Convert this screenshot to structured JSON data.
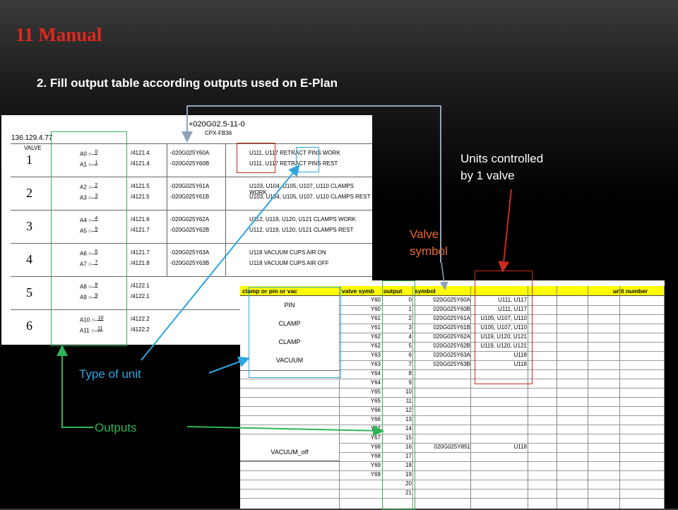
{
  "slide": {
    "title": "11 Manual",
    "subtitle": "2. Fill output table according outputs used on E-Plan"
  },
  "notes": {
    "units": [
      "Units controlled",
      "by 1 valve"
    ],
    "valve": [
      "Valve",
      "symbol"
    ],
    "type": "Type of unit",
    "outputs": "Outputs"
  },
  "eplan": {
    "ip": "136.129.4.77",
    "header_line1": "+020G02.5-11-0",
    "header_line2": "CPX-FB36",
    "valve_label": "VALVE",
    "rows": [
      {
        "valve": "1",
        "io": [
          [
            "A0",
            "0"
          ],
          [
            "A1",
            "1"
          ]
        ],
        "pages": [
          "/4121.4",
          "/4121.4"
        ],
        "codes": [
          "-020G025Y60A",
          "-020G025Y60B"
        ],
        "desc": [
          "U111, U117 RETRACT PINS WORK",
          "U111, U117 RETRACT PINS REST"
        ]
      },
      {
        "valve": "2",
        "io": [
          [
            "A2",
            "2"
          ],
          [
            "A3",
            "3"
          ]
        ],
        "pages": [
          "/4121.5",
          "/4121.5"
        ],
        "codes": [
          "-020G025Y61A",
          "-020G025Y61B"
        ],
        "desc": [
          "U103, U104, U105, U107, U110 CLAMPS WORK",
          "U103, U104, U105, U107, U110 CLAMPS REST"
        ]
      },
      {
        "valve": "3",
        "io": [
          [
            "A4",
            "4"
          ],
          [
            "A5",
            "5"
          ]
        ],
        "pages": [
          "/4121.6",
          "/4121.7"
        ],
        "codes": [
          "-020G025Y62A",
          "-020G025Y62B"
        ],
        "desc": [
          "U112, U119, U120, U121 CLAMPS WORK",
          "U112, U119, U120, U121 CLAMPS REST"
        ]
      },
      {
        "valve": "4",
        "io": [
          [
            "A6",
            "6"
          ],
          [
            "A7",
            "7"
          ]
        ],
        "pages": [
          "/4121.7",
          "/4121.8"
        ],
        "codes": [
          "-020G025Y63A",
          "-020G025Y63B"
        ],
        "desc": [
          "U118 VACUUM CUPS AIR ON",
          "U118 VACUUM CUPS AIR OFF"
        ]
      },
      {
        "valve": "5",
        "io": [
          [
            "A8",
            "8"
          ],
          [
            "A9",
            "9"
          ]
        ],
        "pages": [
          "/4122.1",
          "/4122.1"
        ],
        "codes": [
          "",
          ""
        ],
        "desc": [
          "",
          ""
        ]
      },
      {
        "valve": "6",
        "io": [
          [
            "A10",
            "10"
          ],
          [
            "A11",
            "11"
          ]
        ],
        "pages": [
          "/4122.2",
          "/4122.2"
        ],
        "codes": [
          "",
          ""
        ],
        "desc": [
          "",
          ""
        ]
      }
    ]
  },
  "excel": {
    "headers": {
      "type": "clamp or pin or vac",
      "valve": "valve symb",
      "output": "output",
      "symbol": "symbol",
      "units": "unit number"
    },
    "groups": [
      {
        "name": "PIN",
        "start": 0,
        "span": 2
      },
      {
        "name": "CLAMP",
        "start": 2,
        "span": 2
      },
      {
        "name": "CLAMP",
        "start": 4,
        "span": 2
      },
      {
        "name": "VACUUM",
        "start": 6,
        "span": 2
      },
      {
        "name": "VACUUM_off",
        "start": 16,
        "span": 1
      }
    ],
    "rows": [
      {
        "valve": "Y60",
        "output": "0",
        "symbol": "020G025Y60A",
        "unit": "U111, U117"
      },
      {
        "valve": "Y60",
        "output": "1",
        "symbol": "020G025Y60B",
        "unit": "U111, U117"
      },
      {
        "valve": "Y61",
        "output": "2",
        "symbol": "020G025Y61A",
        "unit": "U105, U107, U110"
      },
      {
        "valve": "Y61",
        "output": "3",
        "symbol": "020G025Y61B",
        "unit": "U105, U107, U110"
      },
      {
        "valve": "Y62",
        "output": "4",
        "symbol": "020G025Y62A",
        "unit": "U119, U120, U121"
      },
      {
        "valve": "Y62",
        "output": "5",
        "symbol": "020G025Y62B",
        "unit": "U119, U120, U121"
      },
      {
        "valve": "Y63",
        "output": "6",
        "symbol": "020G025Y63A",
        "unit": "U118"
      },
      {
        "valve": "Y63",
        "output": "7",
        "symbol": "020G025Y63B",
        "unit": "U118"
      },
      {
        "valve": "Y64",
        "output": "8",
        "symbol": "",
        "unit": ""
      },
      {
        "valve": "Y64",
        "output": "9",
        "symbol": "",
        "unit": ""
      },
      {
        "valve": "Y65",
        "output": "10",
        "symbol": "",
        "unit": ""
      },
      {
        "valve": "Y65",
        "output": "11",
        "symbol": "",
        "unit": ""
      },
      {
        "valve": "Y66",
        "output": "12",
        "symbol": "",
        "unit": ""
      },
      {
        "valve": "Y66",
        "output": "13",
        "symbol": "",
        "unit": ""
      },
      {
        "valve": "Y67",
        "output": "14",
        "symbol": "",
        "unit": ""
      },
      {
        "valve": "Y67",
        "output": "15",
        "symbol": "",
        "unit": ""
      },
      {
        "valve": "Y68",
        "output": "16",
        "symbol": "020G025Y851",
        "unit": "U118"
      },
      {
        "valve": "Y68",
        "output": "17",
        "symbol": "",
        "unit": ""
      },
      {
        "valve": "Y69",
        "output": "18",
        "symbol": "",
        "unit": ""
      },
      {
        "valve": "Y69",
        "output": "19",
        "symbol": "",
        "unit": ""
      },
      {
        "valve": "",
        "output": "20",
        "symbol": "",
        "unit": ""
      },
      {
        "valve": "",
        "output": "21",
        "symbol": "",
        "unit": ""
      }
    ]
  },
  "colors": {
    "title": "#e0281e",
    "units_box": "#cc2a1e",
    "valve_note": "#e86a2a",
    "type_box": "#2ea6df",
    "outputs_box": "#2fb457",
    "symbol_line": "#8fa4b8",
    "header_fill": "#ffff00"
  }
}
